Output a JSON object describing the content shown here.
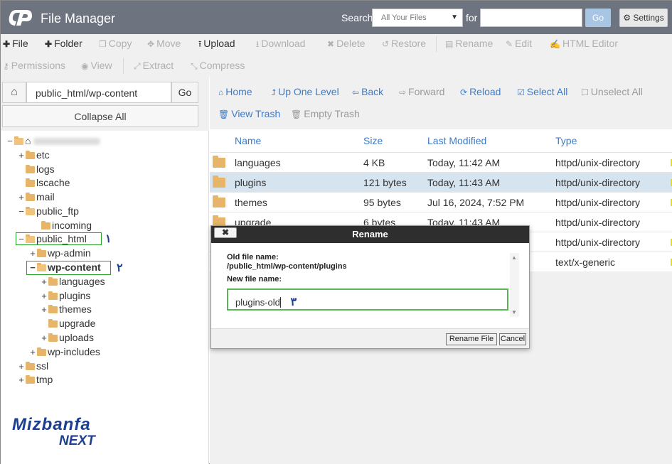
{
  "app": {
    "title": "File Manager"
  },
  "search": {
    "label": "Search",
    "scope": "All Your Files",
    "for_label": "for",
    "go": "Go",
    "settings": "Settings"
  },
  "toolbar": {
    "file": "File",
    "folder": "Folder",
    "copy": "Copy",
    "move": "Move",
    "upload": "Upload",
    "download": "Download",
    "delete": "Delete",
    "restore": "Restore",
    "rename": "Rename",
    "edit": "Edit",
    "html_editor": "HTML Editor",
    "permissions": "Permissions",
    "view": "View",
    "extract": "Extract",
    "compress": "Compress"
  },
  "pathbar": {
    "path": "public_html/wp-content",
    "go": "Go",
    "collapse": "Collapse All"
  },
  "tree": [
    "etc",
    "logs",
    "lscache",
    "mail",
    "public_ftp",
    "incoming",
    "public_html",
    "wp-admin",
    "wp-content",
    "languages",
    "plugins",
    "themes",
    "upgrade",
    "uploads",
    "wp-includes",
    "ssl",
    "tmp"
  ],
  "steps": {
    "one": "١",
    "two": "٢",
    "three": "٣"
  },
  "nav": {
    "home": "Home",
    "up": "Up One Level",
    "back": "Back",
    "forward": "Forward",
    "reload": "Reload",
    "select_all": "Select All",
    "unselect_all": "Unselect All",
    "view_trash": "View Trash",
    "empty_trash": "Empty Trash"
  },
  "table": {
    "headers": {
      "name": "Name",
      "size": "Size",
      "modified": "Last Modified",
      "type": "Type"
    },
    "rows": [
      {
        "name": "languages",
        "size": "4 KB",
        "modified": "Today, 11:42 AM",
        "type": "httpd/unix-directory"
      },
      {
        "name": "plugins",
        "size": "121 bytes",
        "modified": "Today, 11:43 AM",
        "type": "httpd/unix-directory"
      },
      {
        "name": "themes",
        "size": "95 bytes",
        "modified": "Jul 16, 2024, 7:52 PM",
        "type": "httpd/unix-directory"
      },
      {
        "name": "upgrade",
        "size": "6 bytes",
        "modified": "Today, 11:43 AM",
        "type": "httpd/unix-directory"
      },
      {
        "name": "",
        "size": "",
        "modified": "",
        "type": "httpd/unix-directory"
      },
      {
        "name": "",
        "size": "",
        "modified": "",
        "type": "text/x-generic"
      }
    ]
  },
  "dialog": {
    "title": "Rename",
    "close": "✖",
    "old_label": "Old file name:",
    "old_value": "/public_html/wp-content/plugins",
    "new_label": "New file name:",
    "new_value": "plugins-old",
    "rename_btn": "Rename File",
    "cancel_btn": "Cancel"
  },
  "brand": {
    "line1": "Mizbanfa",
    "line2": "NEXT"
  },
  "colors": {
    "topbar": "#6e7380",
    "link": "#3d7cc9",
    "folder": "#e6b56a",
    "highlight": "#27a327",
    "selected_row": "#d6e4ef"
  }
}
